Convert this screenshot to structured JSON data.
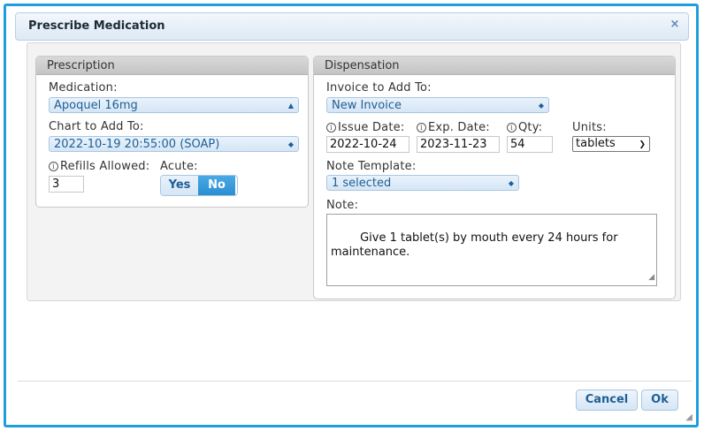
{
  "dialog": {
    "title": "Prescribe Medication",
    "close_glyph": "×"
  },
  "prescription": {
    "heading": "Prescription",
    "medication_label": "Medication:",
    "medication_value": "Apoquel 16mg",
    "chart_label": "Chart to Add To:",
    "chart_value": "2022-10-19 20:55:00 (SOAP)",
    "refills_label": "Refills Allowed:",
    "refills_value": "3",
    "acute_label": "Acute:",
    "acute_yes": "Yes",
    "acute_no": "No",
    "acute_selected": "No"
  },
  "dispensation": {
    "heading": "Dispensation",
    "invoice_label": "Invoice to Add To:",
    "invoice_value": "New Invoice",
    "issue_date_label": "Issue Date:",
    "issue_date_value": "2022-10-24",
    "exp_date_label": "Exp. Date:",
    "exp_date_value": "2023-11-23",
    "qty_label": "Qty:",
    "qty_value": "54",
    "units_label": "Units:",
    "units_value": "tablets",
    "note_template_label": "Note Template:",
    "note_template_value": "1 selected",
    "note_label": "Note:",
    "note_value": "Give 1 tablet(s) by mouth every 24 hours for\nmaintenance."
  },
  "footer": {
    "cancel_label": "Cancel",
    "ok_label": "Ok"
  },
  "icons": {
    "info": "info-icon",
    "select_arrow": "updown-arrow-icon",
    "dropdown_arrow": "chevron-down-icon",
    "close": "close-icon"
  },
  "colors": {
    "accent": "#1e9fdc",
    "button_text": "#1f5f95",
    "toggle_active": "#2b8ed2"
  }
}
